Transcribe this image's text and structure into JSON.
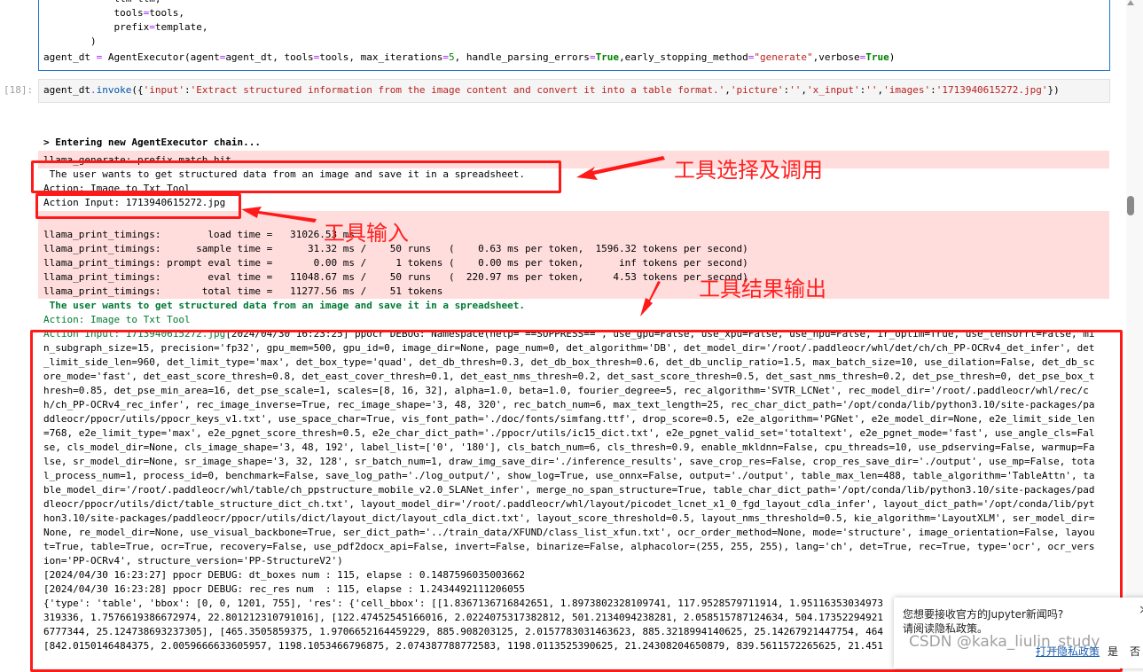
{
  "code_cell": {
    "lines": [
      [
        [
          "            llm=llm,",
          ""
        ]
      ],
      [
        [
          "            tools",
          ""
        ],
        [
          "=",
          "o"
        ],
        [
          "tools,",
          ""
        ]
      ],
      [
        [
          "            prefix",
          ""
        ],
        [
          "=",
          "o"
        ],
        [
          "template,",
          ""
        ]
      ],
      [
        [
          "        )",
          ""
        ]
      ],
      [
        [
          "agent_dt ",
          ""
        ],
        [
          "=",
          "o"
        ],
        [
          " AgentExecutor(agent",
          ""
        ],
        [
          "=",
          "o"
        ],
        [
          "agent_dt, tools",
          ""
        ],
        [
          "=",
          "o"
        ],
        [
          "tools, max_iterations",
          ""
        ],
        [
          "=",
          "o"
        ],
        [
          "5",
          "n"
        ],
        [
          ", handle_parsing_errors",
          ""
        ],
        [
          "=",
          "o"
        ],
        [
          "True",
          "k"
        ],
        [
          ",early_stopping_method",
          ""
        ],
        [
          "=",
          "o"
        ],
        [
          "\"generate\"",
          "s"
        ],
        [
          ",verbose",
          ""
        ],
        [
          "=",
          "o"
        ],
        [
          "True",
          "k"
        ],
        [
          ")",
          ""
        ]
      ]
    ]
  },
  "input_cell": {
    "prompt": "[18]:",
    "tokens": [
      [
        "agent_dt",
        ""
      ],
      [
        ".",
        "o"
      ],
      [
        "invoke",
        "a"
      ],
      [
        "({",
        ""
      ],
      [
        "'input'",
        "s"
      ],
      [
        ":",
        ""
      ],
      [
        "'Extract structured information from the image content and convert it into a table format.'",
        "s"
      ],
      [
        ",",
        ""
      ],
      [
        "'picture'",
        "s"
      ],
      [
        ":",
        ""
      ],
      [
        "''",
        "s"
      ],
      [
        ",",
        ""
      ],
      [
        "'x_input'",
        "s"
      ],
      [
        ":",
        ""
      ],
      [
        "''",
        "s"
      ],
      [
        ",",
        ""
      ],
      [
        "'images'",
        "s"
      ],
      [
        ":",
        ""
      ],
      [
        "'1713940615272.jpg'",
        "s"
      ],
      [
        "})",
        ""
      ]
    ]
  },
  "output": {
    "entering": "> Entering new AgentExecutor chain...",
    "llama_generate": "llama_generate: prefix match hit",
    "thought1": " The user wants to get structured data from an image and save it in a spreadsheet.",
    "action1": "Action: Image to Txt Tool",
    "action_input1": "Action Input: 1713940615272.jpg",
    "timings": [
      "llama_print_timings:        load time =   31026.53 ms",
      "llama_print_timings:      sample time =      31.32 ms /    50 runs   (    0.63 ms per token,  1596.32 tokens per second)",
      "llama_print_timings: prompt eval time =       0.00 ms /     1 tokens (    0.00 ms per token,      inf tokens per second)",
      "llama_print_timings:        eval time =   11048.67 ms /    50 runs   (  220.97 ms per token,     4.53 tokens per second)",
      "llama_print_timings:       total time =   11277.56 ms /    51 tokens"
    ],
    "thought2": " The user wants to get structured data from an image and save it in a spreadsheet.",
    "action2": "Action: Image to Txt Tool",
    "action_input2": "Action Input: 1713940615272.jpg",
    "tool_lines": [
      "[2024/04/30 16:23:25] ppocr DEBUG: Namespace(help='==SUPPRESS==', use_gpu=False, use_xpu=False, use_npu=False, ir_optim=True, use_tensorrt=False, mi",
      "n_subgraph_size=15, precision='fp32', gpu_mem=500, gpu_id=0, image_dir=None, page_num=0, det_algorithm='DB', det_model_dir='/root/.paddleocr/whl/det/ch/ch_PP-OCRv4_det_infer', det",
      "_limit_side_len=960, det_limit_type='max', det_box_type='quad', det_db_thresh=0.3, det_db_box_thresh=0.6, det_db_unclip_ratio=1.5, max_batch_size=10, use_dilation=False, det_db_sc",
      "ore_mode='fast', det_east_score_thresh=0.8, det_east_cover_thresh=0.1, det_east_nms_thresh=0.2, det_sast_score_thresh=0.5, det_sast_nms_thresh=0.2, det_pse_thresh=0, det_pse_box_t",
      "hresh=0.85, det_pse_min_area=16, det_pse_scale=1, scales=[8, 16, 32], alpha=1.0, beta=1.0, fourier_degree=5, rec_algorithm='SVTR_LCNet', rec_model_dir='/root/.paddleocr/whl/rec/c",
      "h/ch_PP-OCRv4_rec_infer', rec_image_inverse=True, rec_image_shape='3, 48, 320', rec_batch_num=6, max_text_length=25, rec_char_dict_path='/opt/conda/lib/python3.10/site-packages/pa",
      "ddleocr/ppocr/utils/ppocr_keys_v1.txt', use_space_char=True, vis_font_path='./doc/fonts/simfang.ttf', drop_score=0.5, e2e_algorithm='PGNet', e2e_model_dir=None, e2e_limit_side_len",
      "=768, e2e_limit_type='max', e2e_pgnet_score_thresh=0.5, e2e_char_dict_path='./ppocr/utils/ic15_dict.txt', e2e_pgnet_valid_set='totaltext', e2e_pgnet_mode='fast', use_angle_cls=Fal",
      "se, cls_model_dir=None, cls_image_shape='3, 48, 192', label_list=['0', '180'], cls_batch_num=6, cls_thresh=0.9, enable_mkldnn=False, cpu_threads=10, use_pdserving=False, warmup=Fa",
      "lse, sr_model_dir=None, sr_image_shape='3, 32, 128', sr_batch_num=1, draw_img_save_dir='./inference_results', save_crop_res=False, crop_res_save_dir='./output', use_mp=False, tota",
      "l_process_num=1, process_id=0, benchmark=False, save_log_path='./log_output/', show_log=True, use_onnx=False, output='./output', table_max_len=488, table_algorithm='TableAttn', ta",
      "ble_model_dir='/root/.paddleocr/whl/table/ch_ppstructure_mobile_v2.0_SLANet_infer', merge_no_span_structure=True, table_char_dict_path='/opt/conda/lib/python3.10/site-packages/pad",
      "dleocr/ppocr/utils/dict/table_structure_dict_ch.txt', layout_model_dir='/root/.paddleocr/whl/layout/picodet_lcnet_x1_0_fgd_layout_cdla_infer', layout_dict_path='/opt/conda/lib/pyt",
      "hon3.10/site-packages/paddleocr/ppocr/utils/dict/layout_dict/layout_cdla_dict.txt', layout_score_threshold=0.5, layout_nms_threshold=0.5, kie_algorithm='LayoutXLM', ser_model_dir=",
      "None, re_model_dir=None, use_visual_backbone=True, ser_dict_path='../train_data/XFUND/class_list_xfun.txt', ocr_order_method=None, mode='structure', image_orientation=False, layou",
      "t=True, table=True, ocr=True, recovery=False, use_pdf2docx_api=False, invert=False, binarize=False, alphacolor=(255, 255, 255), lang='ch', det=True, rec=True, type='ocr', ocr_vers",
      "ion='PP-OCRv4', structure_version='PP-StructureV2')",
      "[2024/04/30 16:23:27] ppocr DEBUG: dt_boxes num : 115, elapse : 0.1487596035003662",
      "[2024/04/30 16:23:28] ppocr DEBUG: rec_res num  : 115, elapse : 1.2434492111206055",
      "{'type': 'table', 'bbox': [0, 0, 1201, 755], 'res': {'cell_bbox': [[1.8367136716842651, 1.8973802328109741, 117.9528579711914, 1.95116353034973",
      "319336, 1.7576619386672974, 22.801212310791016], [122.47452545166016, 2.0224075317382812, 501.2134094238281, 2.058515787124634, 504.17352294921",
      "6777344, 25.124738693237305], [465.3505859375, 1.9706652164459229, 885.908203125, 2.0157783031463623, 885.3218994140625, 25.14267921447754, 464",
      "[842.0150146484375, 2.0059666633605957, 1198.1053466796875, 2.074387788772583, 1198.0113525390625, 21.24308204650879, 839.5611572265625, 21.451"
    ]
  },
  "annotations": {
    "tool_selection": "工具选择及调用",
    "tool_input": "工具输入",
    "tool_output": "工具结果输出",
    "color": "#ff1a1a"
  },
  "popup": {
    "question": "您想要接收官方的Jupyter新闻吗?",
    "privacy_hint": "请阅读隐私政策。",
    "open_privacy": "打开隐私政策",
    "yes": "是",
    "no": "否",
    "close": "×"
  },
  "watermark": "CSDN @kaka_liulin_study"
}
